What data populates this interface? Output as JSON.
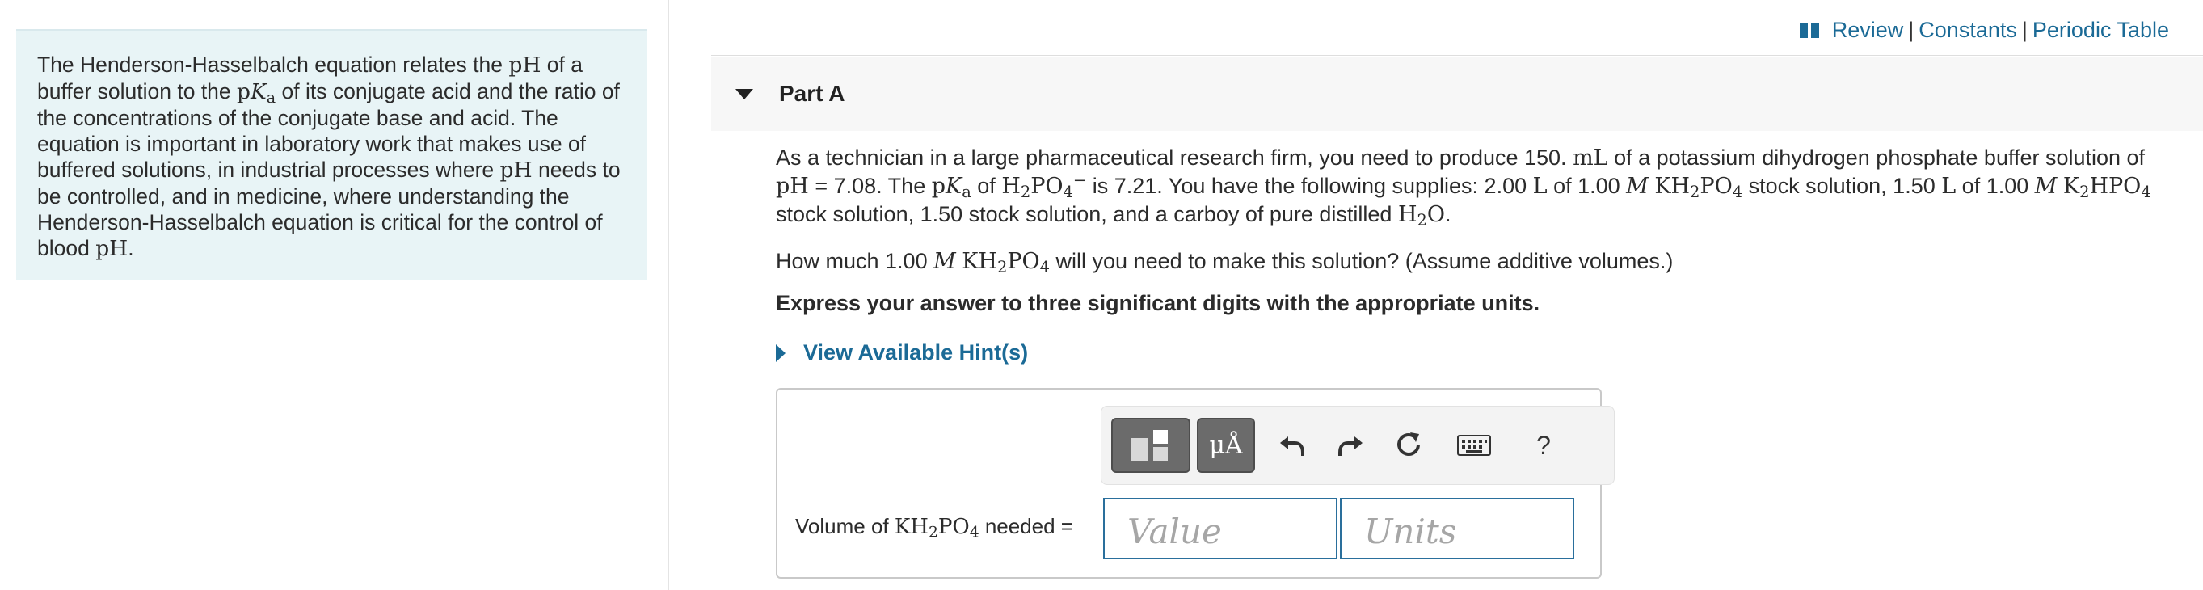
{
  "intro": {
    "l1a": "The Henderson-Hasselbalch equation relates the ",
    "pH": "pH",
    "l1b": " of a buffer solution to the ",
    "pKa_p": "p",
    "pKa_K": "K",
    "pKa_a": "a",
    "l2": " of its conjugate acid and the ratio of the concentrations of the conjugate base and acid. The equation is important in laboratory work that makes use of buffered solutions, in industrial processes where ",
    "pH2": "pH",
    "l3": " needs to be controlled, and in medicine, where understanding the Henderson-Hasselbalch equation is critical for the control of blood ",
    "pH3": "pH",
    "end": "."
  },
  "toplinks": {
    "review": "Review",
    "constants": "Constants",
    "periodic": "Periodic Table",
    "separator": "|"
  },
  "part": {
    "title": "Part A"
  },
  "question": {
    "a": "As a technician in a large pharmaceutical research firm, you need to produce 150. ",
    "mL": "mL",
    "b": " of a potassium dihydrogen phosphate buffer solution of ",
    "pH": "pH",
    "c": " = 7.08. The ",
    "pK": "p",
    "K": "K",
    "a_sub": "a",
    "d": " of ",
    "H": "H",
    "two": "2",
    "PO": "PO",
    "four": "4",
    "minus": "−",
    "e": " is 7.21. You have the following supplies: 2.00 ",
    "L1": "L",
    "f": " of 1.00 ",
    "M1": "M",
    "KH": "KH",
    "g": " stock solution, 1.50 ",
    "L2": "L",
    "h": " of 1.00 ",
    "M2": "M",
    "K2": "K",
    "HPO": "HPO",
    "i": " stock solution, and a carboy of pure distilled ",
    "H2O_H": "H",
    "H2O_O": "O",
    "j": "."
  },
  "q2": {
    "a": "How much 1.00 ",
    "M": "M",
    "KH": "KH",
    "PO": "PO",
    "two": "2",
    "four": "4",
    "b": " will you need to make this solution?  (Assume additive volumes.)"
  },
  "instruction": "Express your answer to three significant digits with the appropriate units.",
  "hints_label": "View Available Hint(s)",
  "toolbar": {
    "mu": "μÅ",
    "help": "?"
  },
  "answer": {
    "label_a": "Volume of ",
    "KH": "KH",
    "two": "2",
    "PO": "PO",
    "four": "4",
    "label_b": " needed =",
    "value_placeholder": "Value",
    "units_placeholder": "Units"
  },
  "colors": {
    "link": "#1b6a96",
    "intro_bg": "#e8f4f6",
    "field_border": "#2a6f9c"
  }
}
